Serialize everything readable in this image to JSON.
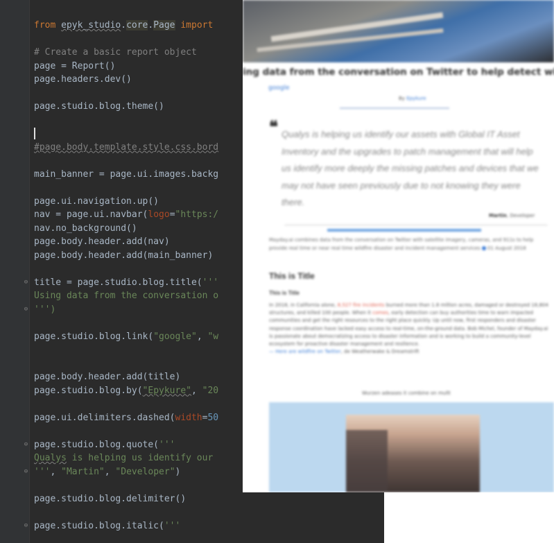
{
  "editor": {
    "lines": [
      {
        "parts": [
          [
            "kw",
            "from "
          ],
          [
            "ul",
            "epyk_studio"
          ],
          [
            "",
            "."
          ],
          [
            "hl",
            "core"
          ],
          [
            "",
            "."
          ],
          [
            "hl",
            "Page"
          ],
          [
            "kw",
            " import"
          ]
        ]
      },
      {
        "parts": []
      },
      {
        "parts": [
          [
            "cm",
            "# Create a basic report object"
          ]
        ]
      },
      {
        "parts": [
          [
            "",
            "page = Report()"
          ]
        ]
      },
      {
        "parts": [
          [
            "",
            "page.headers.dev()"
          ]
        ]
      },
      {
        "parts": []
      },
      {
        "parts": [
          [
            "",
            "page.studio.blog.theme()"
          ]
        ]
      },
      {
        "parts": []
      },
      {
        "parts": [
          [
            "caret",
            ""
          ]
        ]
      },
      {
        "parts": [
          [
            "cmul",
            "#page.body.template.style.css.bord"
          ]
        ]
      },
      {
        "parts": []
      },
      {
        "parts": [
          [
            "",
            "main_banner = page.ui.images.backg"
          ]
        ]
      },
      {
        "parts": []
      },
      {
        "parts": [
          [
            "",
            "page.ui.navigation.up()"
          ]
        ]
      },
      {
        "parts": [
          [
            "",
            "nav = page.ui.navbar("
          ],
          [
            "kwarg",
            "logo"
          ],
          [
            "",
            "="
          ],
          [
            "str",
            "\"https:/"
          ]
        ]
      },
      {
        "parts": [
          [
            "",
            "nav.no_background()"
          ]
        ]
      },
      {
        "parts": [
          [
            "",
            "page.body.header.add(nav)"
          ]
        ]
      },
      {
        "parts": [
          [
            "",
            "page.body.header.add(main_banner)"
          ]
        ]
      },
      {
        "parts": []
      },
      {
        "parts": [
          [
            "",
            "title = page.studio.blog.title("
          ],
          [
            "str",
            "'''"
          ]
        ]
      },
      {
        "parts": [
          [
            "str",
            "Using data from the conversation o"
          ]
        ]
      },
      {
        "parts": [
          [
            "str",
            "''')"
          ]
        ]
      },
      {
        "parts": []
      },
      {
        "parts": [
          [
            "",
            "page.studio.blog.link("
          ],
          [
            "str",
            "\"google\""
          ],
          [
            "",
            ", "
          ],
          [
            "str",
            "\"w"
          ]
        ]
      },
      {
        "parts": []
      },
      {
        "parts": []
      },
      {
        "parts": [
          [
            "",
            "page.body.header.add(title)"
          ]
        ]
      },
      {
        "parts": [
          [
            "",
            "page.studio.blog.by("
          ],
          [
            "strul",
            "\"Epykure\""
          ],
          [
            "",
            ", "
          ],
          [
            "str",
            "\"20"
          ]
        ]
      },
      {
        "parts": []
      },
      {
        "parts": [
          [
            "",
            "page.ui.delimiters.dashed("
          ],
          [
            "kwarg",
            "width"
          ],
          [
            "",
            "="
          ],
          [
            "num",
            "50"
          ]
        ]
      },
      {
        "parts": []
      },
      {
        "parts": [
          [
            "",
            "page.studio.blog.quote("
          ],
          [
            "str",
            "'''"
          ]
        ]
      },
      {
        "parts": [
          [
            "strul",
            "Qualys"
          ],
          [
            "str",
            " is helping us identify our"
          ]
        ]
      },
      {
        "parts": [
          [
            "str",
            "'''"
          ],
          [
            "",
            ", "
          ],
          [
            "str",
            "\"Martin\""
          ],
          [
            "",
            ", "
          ],
          [
            "str",
            "\"Developer\""
          ],
          [
            "",
            ")"
          ]
        ]
      },
      {
        "parts": []
      },
      {
        "parts": [
          [
            "",
            "page.studio.blog.delimiter()"
          ]
        ]
      },
      {
        "parts": []
      },
      {
        "parts": [
          [
            "",
            "page.studio.blog.italic("
          ],
          [
            "str",
            "'''"
          ]
        ]
      }
    ],
    "folds": [
      {
        "line": 19,
        "glyph": "⊖"
      },
      {
        "line": 21,
        "glyph": "⊖"
      },
      {
        "line": 31,
        "glyph": "⊖"
      },
      {
        "line": 33,
        "glyph": "⊖"
      },
      {
        "line": 37,
        "glyph": "⊖"
      }
    ]
  },
  "preview": {
    "title": "ing data from the conversation on Twitter to help detect wildfires",
    "link": "google",
    "by_label": "By",
    "by_author": "Epykure",
    "quote_mark": "❝",
    "quote": "Qualys is helping us identify our assets with Global IT Asset Inventory and the upgrades to patch management that will help us identify more deeply the missing patches and devices that we may not have seen previously due to not knowing they were there.",
    "quote_author": "Martin",
    "quote_role": "Developer",
    "intro": "Mayday.ai combines data from the conversation on Twitter with satellite imagery, cameras, and 911s to help provide real time or near real time wildfire disaster and incident management services",
    "intro_date": "01 August 2018",
    "heading": "This is Title",
    "subheading": "This is Title",
    "body_a": "In 2018, in California alone, ",
    "body_red1": "8,527 fire incidents",
    "body_b": " burned more than 1.8 million acres, damaged or destroyed 18,804 structures, and killed 100 people. When it ",
    "body_red2": "comes",
    "body_c": ", early detection can buy authorities time to warn impacted communities and get the right resources to the right place quickly. Up until now, first responders and disaster response coordination have lacked easy access to real-time, on-the-ground data. Bob Michel, founder of Mayday.ai is passionate about democratizing access to disaster information and is working to build a community-level ecosystem for proactive disaster management and resilience.",
    "body_link": "— Here are wildfire on Twitter",
    "body_tail": ", de Weatherwake & Dreamstrift",
    "caption": "Wurzen adeases it combine on mullt"
  }
}
